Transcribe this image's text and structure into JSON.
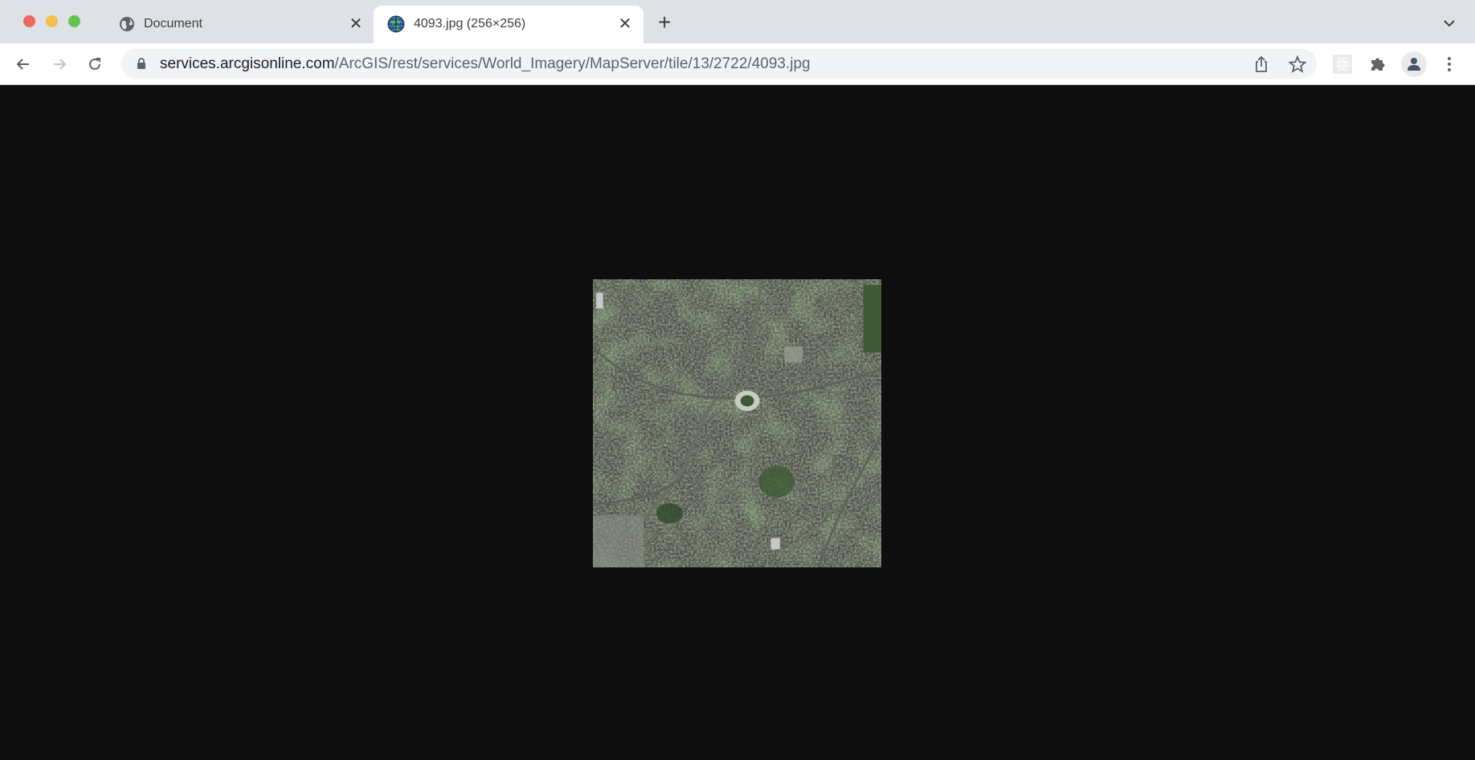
{
  "window": {
    "controls": [
      "close",
      "minimize",
      "maximize"
    ]
  },
  "tabs": [
    {
      "title": "Document",
      "icon": "globe-icon",
      "active": false
    },
    {
      "title": "4093.jpg (256×256)",
      "icon": "arcgis-globe-icon",
      "active": true
    }
  ],
  "toolbar": {
    "url_host": "services.arcgisonline.com",
    "url_path": "/ArcGIS/rest/services/World_Imagery/MapServer/tile/13/2722/4093.jpg"
  },
  "content": {
    "image": "satellite imagery tile"
  },
  "colors": {
    "tabbar": "#dee1e6",
    "page_bg": "#0e0e0e",
    "red": "#ed6a5e",
    "yellow": "#f5bf4f",
    "green": "#61c554"
  }
}
